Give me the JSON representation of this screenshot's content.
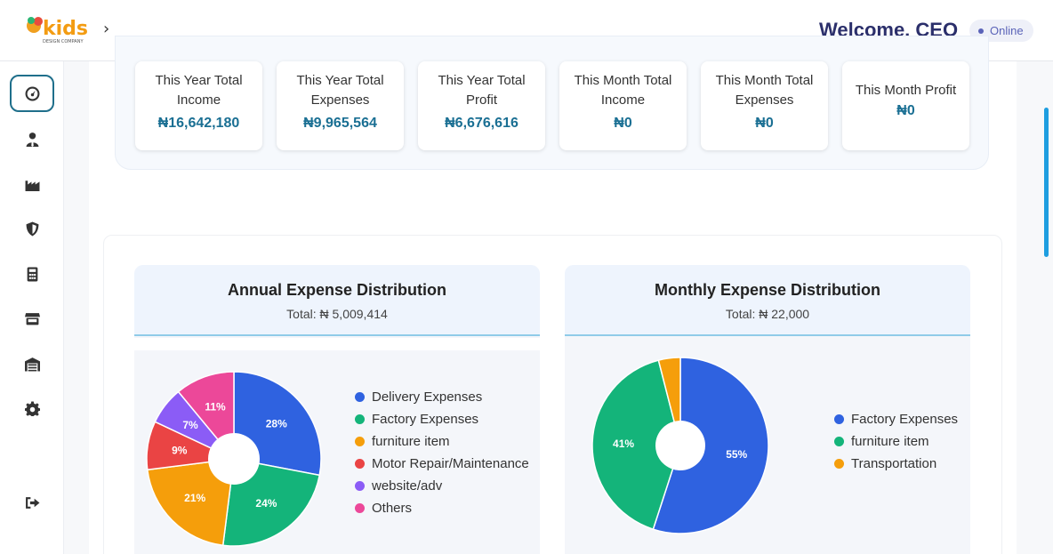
{
  "header": {
    "logo_text": "kids",
    "logo_subtext": "DESIGN COMPANY",
    "welcome": "Welcome, CEO",
    "status": "Online"
  },
  "sidebar": {
    "items": [
      {
        "icon": "dashboard-gauge-icon",
        "active": true
      },
      {
        "icon": "user-tie-icon"
      },
      {
        "icon": "factory-icon"
      },
      {
        "icon": "shield-icon"
      },
      {
        "icon": "calculator-icon"
      },
      {
        "icon": "store-icon"
      },
      {
        "icon": "warehouse-icon"
      },
      {
        "icon": "gear-icon"
      },
      {
        "icon": "logout-icon"
      }
    ]
  },
  "stats": [
    {
      "label": "This Year Total Income",
      "value": "₦16,642,180"
    },
    {
      "label": "This Year Total Expenses",
      "value": "₦9,965,564"
    },
    {
      "label": "This Year Total Profit",
      "value": "₦6,676,616"
    },
    {
      "label": "This Month Total Income",
      "value": "₦0"
    },
    {
      "label": "This Month Total Expenses",
      "value": "₦0"
    },
    {
      "label": "This Month Profit",
      "value": "₦0"
    }
  ],
  "charts": {
    "annual": {
      "title": "Annual Expense Distribution",
      "total": "Total: ₦ 5,009,414"
    },
    "monthly": {
      "title": "Monthly Expense Distribution",
      "total": "Total: ₦ 22,000"
    }
  },
  "chart_data": [
    {
      "type": "pie",
      "title": "Annual Expense Distribution",
      "categories": [
        "Delivery Expenses",
        "Factory Expenses",
        "furniture item",
        "Motor Repair/Maintenance",
        "website/adv",
        "Others"
      ],
      "values": [
        28,
        24,
        21,
        9,
        7,
        11
      ],
      "labels": [
        "28%",
        "24%",
        "21%",
        "9%",
        "7%",
        "11%"
      ],
      "colors": [
        "#2f62e0",
        "#14b47a",
        "#f59e0b",
        "#ea4444",
        "#8b5cf6",
        "#ec4899"
      ],
      "legend": "right"
    },
    {
      "type": "pie",
      "title": "Monthly Expense Distribution",
      "categories": [
        "Factory Expenses",
        "furniture item",
        "Transportation"
      ],
      "values": [
        55,
        41,
        4
      ],
      "labels": [
        "55%",
        "41%",
        ""
      ],
      "colors": [
        "#2f62e0",
        "#14b47a",
        "#f59e0b"
      ],
      "legend": "right"
    }
  ]
}
